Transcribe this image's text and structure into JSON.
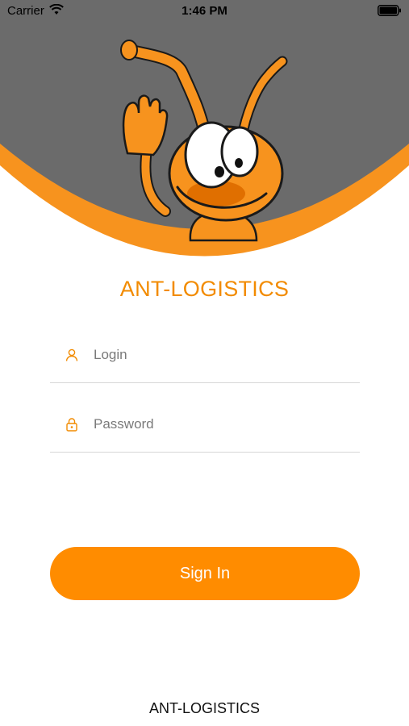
{
  "status_bar": {
    "carrier": "Carrier",
    "time": "1:46 PM"
  },
  "header": {
    "mascot_icon": "ant-mascot-waving"
  },
  "app_title": "ANT-LOGISTICS",
  "login_form": {
    "login": {
      "placeholder": "Login",
      "value": "",
      "icon": "user-icon"
    },
    "password": {
      "placeholder": "Password",
      "value": "",
      "icon": "lock-icon"
    }
  },
  "sign_in_label": "Sign In",
  "footer": "ANT-LOGISTICS",
  "colors": {
    "accent": "#ff8c00",
    "title": "#f28b00",
    "header_background": "#6b6b6b"
  }
}
